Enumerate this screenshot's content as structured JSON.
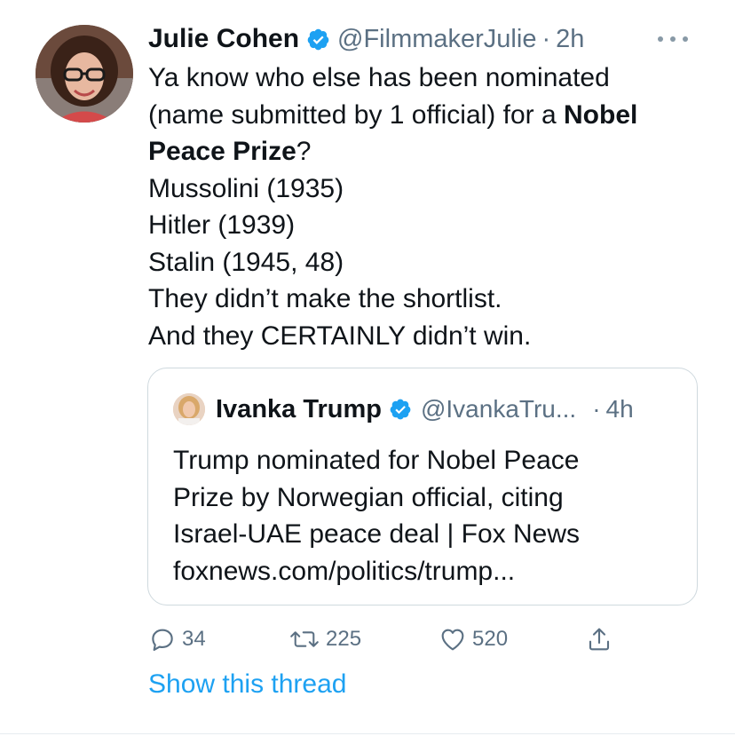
{
  "tweet": {
    "author_name": "Julie Cohen",
    "author_handle": "@FilmmakerJulie",
    "separator": "·",
    "time": "2h",
    "text_lines": {
      "l1": "Ya know who else has been nominated",
      "l2_a": "(name submitted by 1 official) for a ",
      "l2_b": "Nobel",
      "l3_a": "Peace Prize",
      "l3_b": "?",
      "l4": "Mussolini (1935)",
      "l5": "Hitler (1939)",
      "l6": "Stalin (1945, 48)",
      "l7": "They didn’t make the shortlist.",
      "l8": "And they CERTAINLY didn’t win."
    }
  },
  "quote": {
    "author_name": "Ivanka Trump",
    "author_handle": "@IvankaTru...",
    "separator": "·",
    "time": "4h",
    "text_lines": {
      "l1": "Trump nominated for Nobel Peace",
      "l2": "Prize by Norwegian official, citing",
      "l3": "Israel-UAE peace deal | Fox News",
      "l4": "foxnews.com/politics/trump..."
    }
  },
  "actions": {
    "reply_count": "34",
    "retweet_count": "225",
    "like_count": "520"
  },
  "show_thread_label": "Show this thread",
  "colors": {
    "accent": "#1da1f2",
    "secondary_text": "#5b7083",
    "primary_text": "#0f1419",
    "border": "#cfd9de"
  },
  "icons": {
    "verified": "verified-badge-icon",
    "more": "more-dots-icon",
    "reply": "reply-bubble-icon",
    "retweet": "retweet-icon",
    "like": "heart-icon",
    "share": "share-icon"
  }
}
